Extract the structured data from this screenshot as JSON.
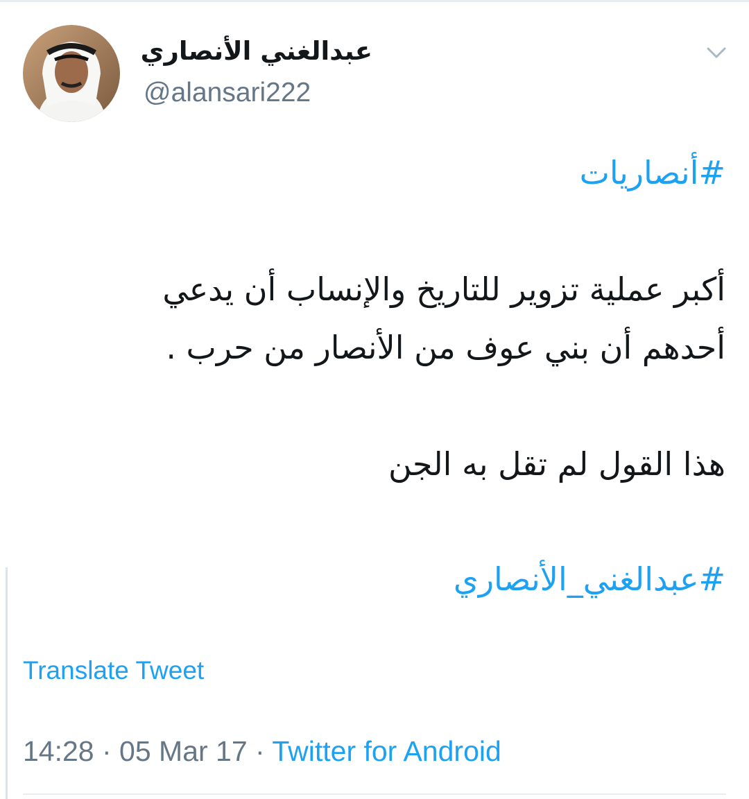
{
  "author": {
    "display_name": "عبدالغني  الأنصاري",
    "handle": "@alansari222",
    "avatar_icon": "user-avatar-photo"
  },
  "tweet": {
    "hashtag_top": "#أنصاريات",
    "line1": "أكبر عملية تزوير للتاريخ والإنساب  أن يدعي",
    "line2": "أحدهم أن بني عوف من الأنصار  من حرب .",
    "line3": "هذا القول لم تقل به الجن",
    "hashtag_bottom": "#عبدالغني_الأنصاري"
  },
  "actions": {
    "translate_label": "Translate Tweet",
    "menu_icon": "chevron-down-icon"
  },
  "meta": {
    "time": "14:28",
    "separator": " · ",
    "date": "05 Mar 17",
    "source": "Twitter for Android"
  },
  "colors": {
    "accent": "#1da1f2",
    "secondary_text": "#657786",
    "primary_text": "#14171a"
  }
}
